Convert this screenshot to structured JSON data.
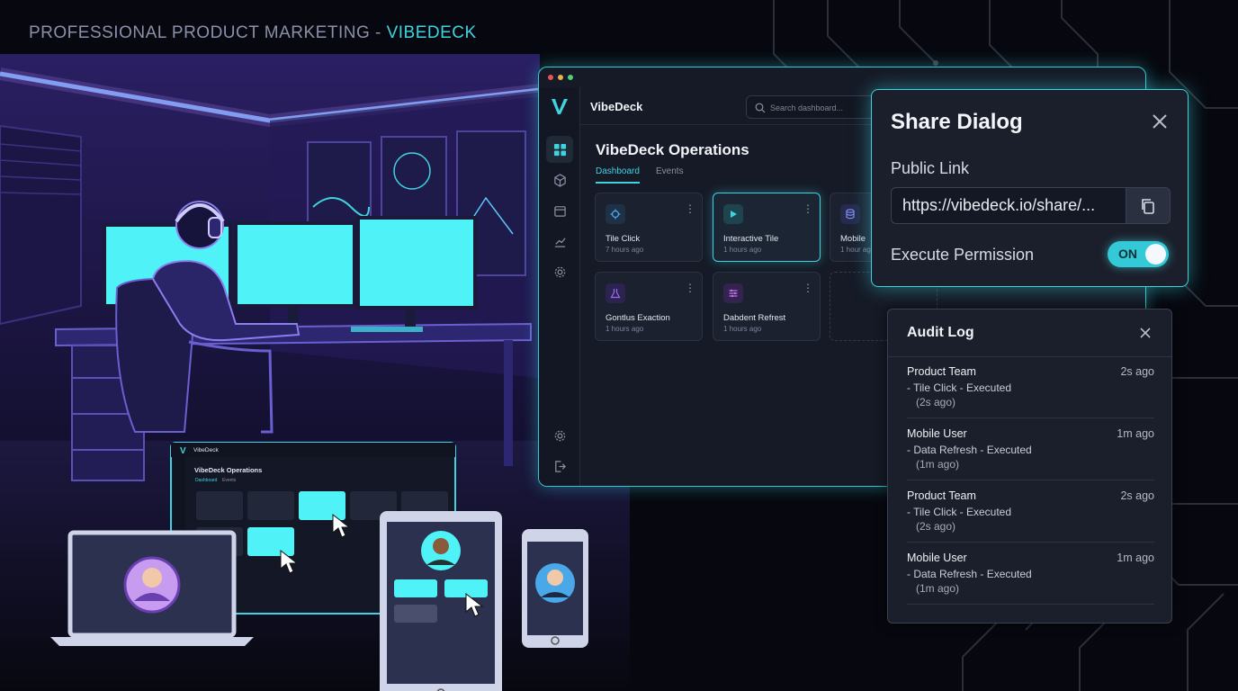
{
  "headline": {
    "prefix": "PROFESSIONAL PRODUCT MARKETING - ",
    "brand": "VIBEDECK"
  },
  "colors": {
    "accent": "#3fd3e0",
    "panel": "#1b1f2b",
    "window": "#151a26",
    "background": "#07080f"
  },
  "app": {
    "name": "VibeDeck",
    "logo_icon": "v-logo-icon",
    "search_placeholder": "Search dashboard...",
    "nav_icons": [
      "grid-icon",
      "cube-icon",
      "calendar-icon",
      "chart-icon",
      "gear-icon"
    ],
    "footer_icons": [
      "settings-icon",
      "logout-icon"
    ],
    "page_title": "VibeDeck Operations",
    "tabs": [
      {
        "label": "Dashboard",
        "active": true
      },
      {
        "label": "Events",
        "active": false
      }
    ],
    "tiles": [
      {
        "name": "Tile Click",
        "time": "7 hours ago",
        "icon": "crosshair-icon",
        "icon_color": "#4aa7e8"
      },
      {
        "name": "Interactive Tile",
        "time": "1 hours ago",
        "icon": "play-icon",
        "icon_color": "#3fd3e0",
        "highlighted": true
      },
      {
        "name": "Mobile",
        "time": "1 hour ago",
        "icon": "database-icon",
        "icon_color": "#7f8ef0"
      },
      {
        "name": "Gontlus Exaction",
        "time": "1 hours ago",
        "icon": "flask-icon",
        "icon_color": "#9d6cf0"
      },
      {
        "name": "Dabdent Refrest",
        "time": "1 hours ago",
        "icon": "sliders-icon",
        "icon_color": "#c46cf0"
      }
    ]
  },
  "share_dialog": {
    "title": "Share Dialog",
    "public_link_label": "Public Link",
    "public_link_value": "https://vibedeck.io/share/...",
    "execute_permission_label": "Execute Permission",
    "toggle_state": "ON"
  },
  "audit_log": {
    "title": "Audit Log",
    "entries": [
      {
        "user": "Product Team",
        "time": "2s ago",
        "action": "- Tile Click - Executed",
        "detail": "(2s ago)"
      },
      {
        "user": "Mobile User",
        "time": "1m ago",
        "action": "- Data Refresh - Executed",
        "detail": "(1m ago)"
      },
      {
        "user": "Product Team",
        "time": "2s ago",
        "action": "- Tile Click - Executed",
        "detail": "(2s ago)"
      },
      {
        "user": "Mobile User",
        "time": "1m ago",
        "action": "- Data Refresh - Executed",
        "detail": "(1m ago)"
      }
    ]
  },
  "mini_dashboard": {
    "app_name": "VibeDeck",
    "page_title": "VibeDeck Operations",
    "tabs": [
      "Dashboard",
      "Events"
    ]
  }
}
